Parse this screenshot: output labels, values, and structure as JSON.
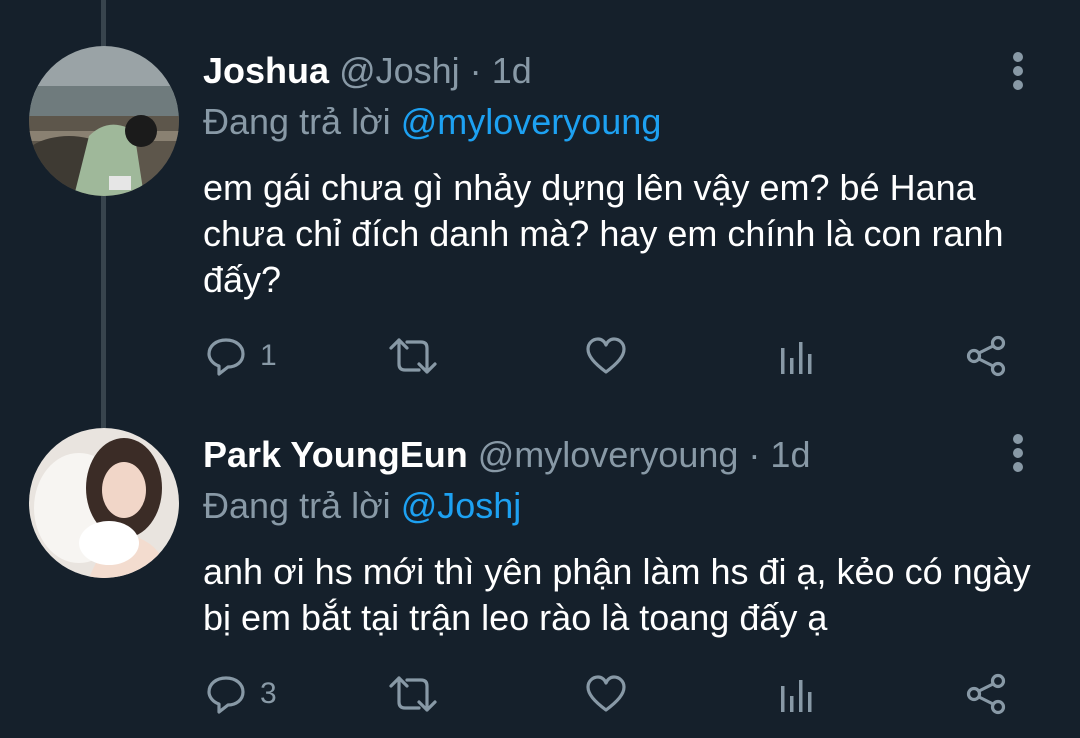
{
  "tweets": [
    {
      "name": "Joshua",
      "handle": "@Joshj",
      "separator": "·",
      "time": "1d",
      "reply_prefix": "Đang trả lời",
      "reply_mention": "@myloveryoung",
      "text": "em gái chưa gì nhảy dựng lên vậy em? bé Hana chưa chỉ đích danh mà? hay em chính là con ranh đấy?",
      "reply_count": "1"
    },
    {
      "name": "Park YoungEun",
      "handle": "@myloveryoung",
      "separator": "·",
      "time": "1d",
      "reply_prefix": "Đang trả lời",
      "reply_mention": "@Joshj",
      "text": "anh ơi hs mới thì yên phận làm hs đi ạ, kẻo có ngày bị em bắt tại trận leo rào là toang đấy ạ",
      "reply_count": "3"
    }
  ],
  "icons": {
    "reply": "reply-icon",
    "retweet": "retweet-icon",
    "like": "heart-icon",
    "analytics": "analytics-icon",
    "share": "share-icon",
    "more": "more-vertical-icon"
  },
  "colors": {
    "background": "#15202b",
    "primary_text": "#ffffff",
    "secondary_text": "#8899a6",
    "accent": "#1da1f2",
    "thread_line": "#38444d"
  }
}
